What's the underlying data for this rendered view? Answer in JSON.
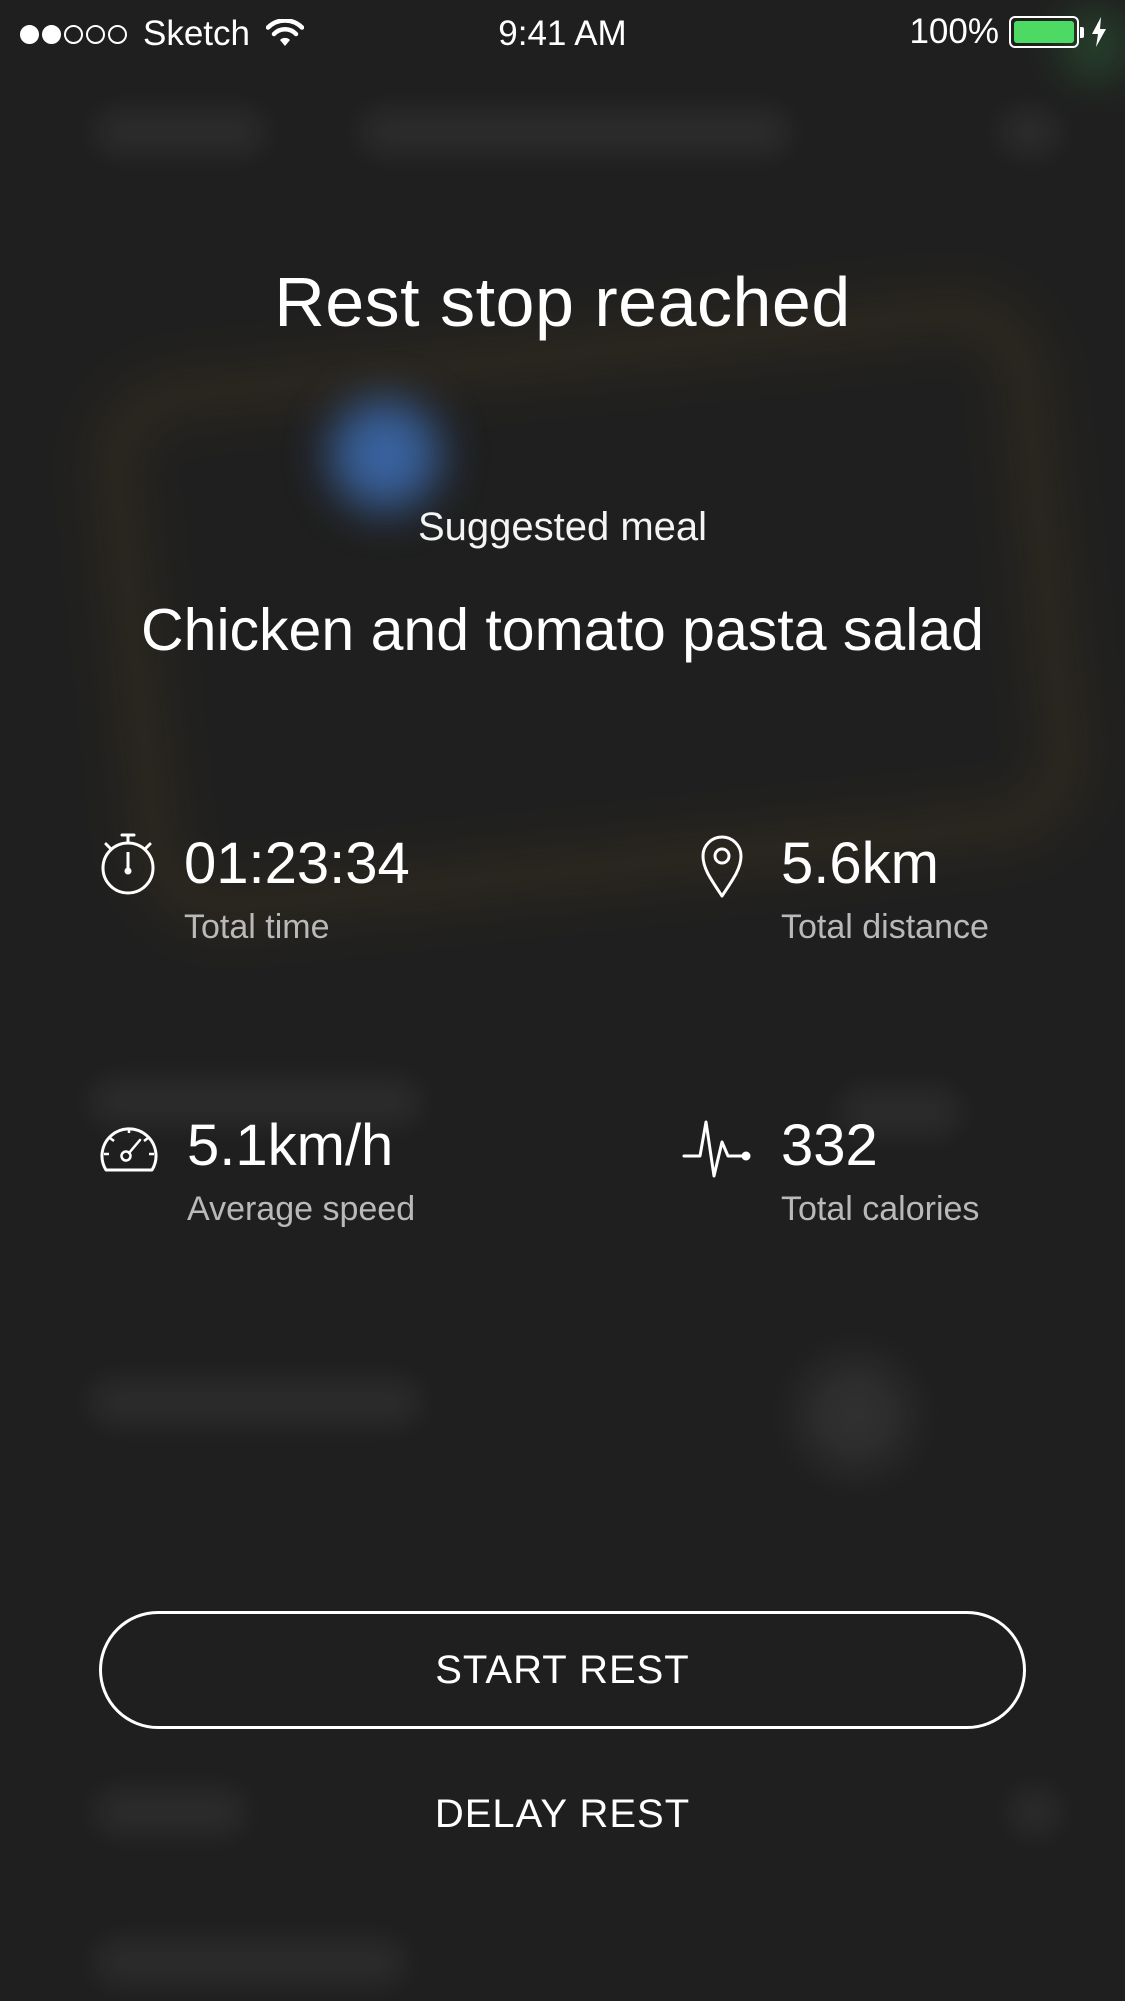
{
  "status_bar": {
    "carrier": "Sketch",
    "time": "9:41 AM",
    "battery_percent": "100%",
    "signal_bars_filled": 2,
    "signal_bars_total": 5,
    "battery_color": "#4cd964"
  },
  "rest": {
    "title": "Rest stop reached",
    "meal_label": "Suggested meal",
    "meal_name": "Chicken and tomato pasta salad"
  },
  "stats": {
    "time": {
      "value": "01:23:34",
      "label": "Total time",
      "icon": "stopwatch-icon"
    },
    "distance": {
      "value": "5.6km",
      "label": "Total distance",
      "icon": "location-pin-icon"
    },
    "speed": {
      "value": "5.1km/h",
      "label": "Average speed",
      "icon": "speedometer-icon"
    },
    "calories": {
      "value": "332",
      "label": "Total calories",
      "icon": "heartbeat-icon"
    }
  },
  "actions": {
    "start_label": "START REST",
    "delay_label": "DELAY REST"
  },
  "colors": {
    "background": "#202020",
    "text": "#ffffff",
    "secondary_text": "#b9b9b9",
    "location_dot": "#3a6fb0"
  }
}
